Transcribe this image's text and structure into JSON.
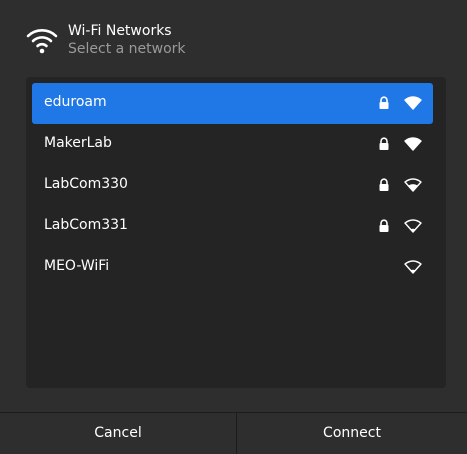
{
  "header": {
    "icon": "wifi-icon",
    "title": "Wi-Fi Networks",
    "subtitle": "Select a network"
  },
  "networks": [
    {
      "name": "eduroam",
      "secured": true,
      "signal": "wifi-signal-full-icon",
      "selected": true
    },
    {
      "name": "MakerLab",
      "secured": true,
      "signal": "wifi-signal-full-icon",
      "selected": false
    },
    {
      "name": "LabCom330",
      "secured": true,
      "signal": "wifi-signal-good-icon",
      "selected": false
    },
    {
      "name": "LabCom331",
      "secured": true,
      "signal": "wifi-signal-weak-icon",
      "selected": false
    },
    {
      "name": "MEO-WiFi",
      "secured": false,
      "signal": "wifi-signal-weak-icon",
      "selected": false
    }
  ],
  "footer": {
    "cancel_label": "Cancel",
    "connect_label": "Connect"
  },
  "colors": {
    "accent": "#1f78e6",
    "background": "#2e2e2e",
    "list_background": "#242424",
    "subtitle": "#9a9a9a"
  }
}
